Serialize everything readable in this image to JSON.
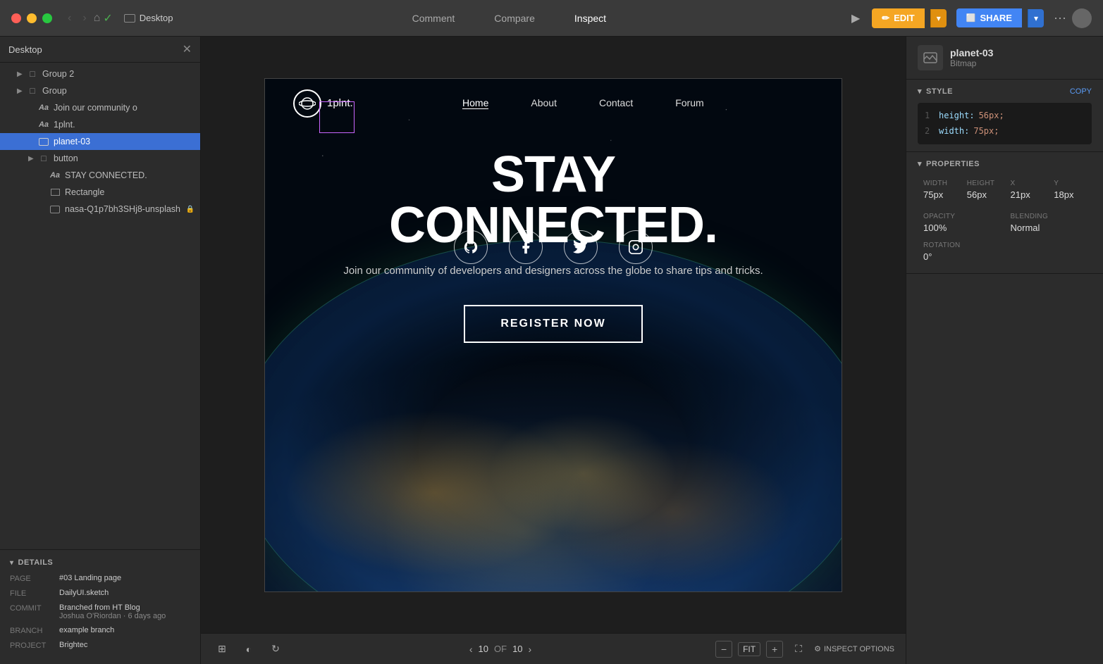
{
  "titlebar": {
    "tab_label": "Desktop",
    "nav_comment": "Comment",
    "nav_compare": "Compare",
    "nav_inspect": "Inspect",
    "btn_edit": "EDIT",
    "btn_share": "SHARE",
    "btn_play_icon": "▶",
    "btn_dots": "···",
    "chevron_down": "▾"
  },
  "sidebar": {
    "title": "Desktop",
    "items": [
      {
        "id": "group2",
        "label": "Group 2",
        "type": "group",
        "indent": 0,
        "expanded": false
      },
      {
        "id": "group",
        "label": "Group",
        "type": "group",
        "indent": 0,
        "expanded": false
      },
      {
        "id": "join",
        "label": "Join our community o",
        "type": "text",
        "indent": 1
      },
      {
        "id": "1plnt",
        "label": "1plnt.",
        "type": "text",
        "indent": 1
      },
      {
        "id": "planet03",
        "label": "planet-03",
        "type": "image",
        "indent": 1,
        "selected": true
      },
      {
        "id": "button",
        "label": "button",
        "type": "group",
        "indent": 1,
        "expanded": false
      },
      {
        "id": "stay",
        "label": "STAY CONNECTED.",
        "type": "text",
        "indent": 2
      },
      {
        "id": "rectangle",
        "label": "Rectangle",
        "type": "rect",
        "indent": 2
      },
      {
        "id": "nasa",
        "label": "nasa-Q1p7bh3SHj8-unsplash",
        "type": "image",
        "indent": 2,
        "locked": true
      }
    ]
  },
  "details": {
    "section_title": "DETAILS",
    "page_label": "PAGE",
    "page_value": "#03 Landing page",
    "file_label": "FILE",
    "file_value": "DailyUI.sketch",
    "commit_label": "COMMIT",
    "commit_value": "Branched from HT Blog",
    "commit_sub": "Joshua O'Riordan · 6 days ago",
    "branch_label": "BRANCH",
    "branch_value": "example branch",
    "project_label": "PROJECT",
    "project_value": "Brightec"
  },
  "canvas": {
    "page_current": "10",
    "page_total": "10",
    "zoom_label": "FIT",
    "inspect_options": "INSPECT OPTIONS"
  },
  "design": {
    "logo_text": "1plnt.",
    "nav_home": "Home",
    "nav_about": "About",
    "nav_contact": "Contact",
    "nav_forum": "Forum",
    "hero_line1": "STAY",
    "hero_line2": "CONNECTED.",
    "hero_subtitle": "Join our community of developers and designers across the globe to share tips and tricks.",
    "cta_button": "REGISTER NOW"
  },
  "right_panel": {
    "title": "planet-03",
    "subtitle": "Bitmap",
    "style_label": "STYLE",
    "copy_label": "COPY",
    "code_lines": [
      {
        "num": "1",
        "prop": "height:",
        "val": "56px;"
      },
      {
        "num": "2",
        "prop": "width:",
        "val": "75px;"
      }
    ],
    "properties_label": "PROPERTIES",
    "width_label": "WIDTH",
    "width_value": "75px",
    "height_label": "HEIGHT",
    "height_value": "56px",
    "x_label": "X",
    "x_value": "21px",
    "y_label": "Y",
    "y_value": "18px",
    "opacity_label": "OPACITY",
    "opacity_value": "100%",
    "blending_label": "BLENDING",
    "blending_value": "Normal",
    "rotation_label": "ROTATION",
    "rotation_value": "0°"
  }
}
